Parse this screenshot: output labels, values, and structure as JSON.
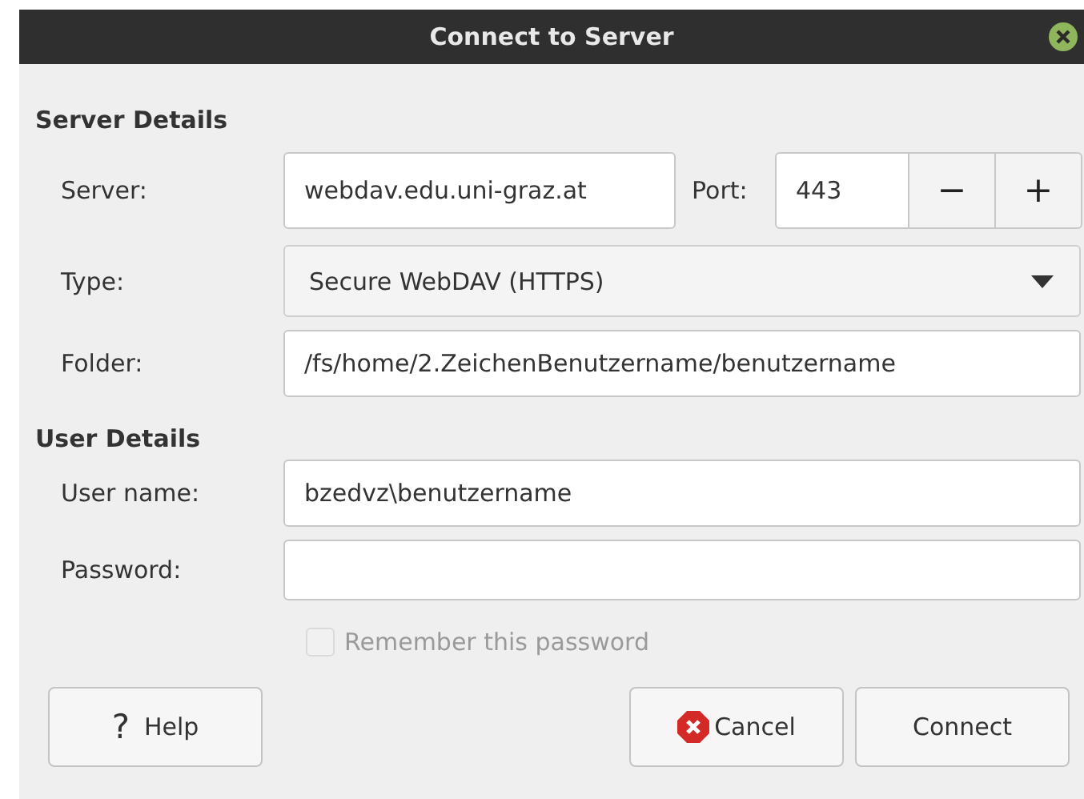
{
  "window": {
    "title": "Connect to Server"
  },
  "server_details": {
    "heading": "Server Details",
    "server": {
      "label": "Server:",
      "value": "webdav.edu.uni-graz.at"
    },
    "port": {
      "label": "Port:",
      "value": "443",
      "decrement": "−",
      "increment": "+"
    },
    "type": {
      "label": "Type:",
      "value": "Secure WebDAV (HTTPS)"
    },
    "folder": {
      "label": "Folder:",
      "value": "/fs/home/2.ZeichenBenutzername/benutzername"
    }
  },
  "user_details": {
    "heading": "User Details",
    "user_name": {
      "label": "User name:",
      "value": "bzedvz\\benutzername"
    },
    "password": {
      "label": "Password:"
    },
    "remember": {
      "label": "Remember this password",
      "checked": false,
      "disabled": true
    }
  },
  "buttons": [
    {
      "kind": "help",
      "icon_text": "?",
      "label": "Help"
    },
    {
      "kind": "cancel",
      "label": "Cancel"
    },
    {
      "kind": "connect",
      "label": "Connect"
    }
  ]
}
